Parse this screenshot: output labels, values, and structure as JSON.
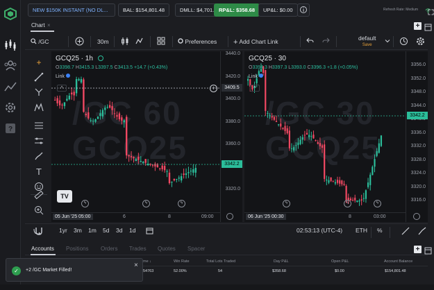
{
  "topbar": {
    "account_label": "NEW $150K INSTANT (NO DL...",
    "bal": "BAL: $154,801.48",
    "dmll": "DMLL: $4,701.48",
    "rpl": "RP&L: $358.68",
    "upl": "UP&L: $0.00",
    "refresh": "Refresh Rate: Medium"
  },
  "chart_tabs": {
    "active": "Chart",
    "close": "×"
  },
  "toolbar": {
    "symbol": "/GC",
    "interval": "30m",
    "preferences": "Preferences",
    "add_link": "Add Chart Link",
    "layout_name": "default",
    "layout_save": "Save"
  },
  "left_pane": {
    "watermark1": "/GC 60",
    "watermark2": "GCQ25",
    "symbol": "GCQ25 · 1h",
    "o": "3398.7",
    "h": "3415.3",
    "l": "3397.5",
    "c": "3413.5",
    "chg": "+14.7 (+0.43%)",
    "link": "Link",
    "crosshair_price": "3409.5",
    "last_price": "3342.2",
    "y_labels": [
      "3440.0",
      "3420.0",
      "3400.0",
      "3380.0",
      "3360.0",
      "3340.0",
      "3320.0"
    ],
    "x_labels": [
      "05 Jun '25  05:00",
      "6",
      "8",
      "09:00"
    ]
  },
  "right_pane": {
    "watermark1": "/GC 30",
    "watermark2": "GCQ25",
    "symbol": "GCQ25 · 30",
    "o": "3394.3",
    "h": "3397.3",
    "l": "3393.0",
    "c": "3396.3",
    "chg": "+1.8 (+0.05%)",
    "link": "Link",
    "last_price": "3342.2",
    "y_labels": [
      "3356.0",
      "3352.0",
      "3348.0",
      "3344.0",
      "3340.0",
      "3336.0",
      "3332.0",
      "3328.0",
      "3324.0",
      "3320.0",
      "3316.0"
    ],
    "x_labels": [
      "06 Jun '25  00:30",
      "8",
      "03:00"
    ]
  },
  "rangebar": {
    "ranges": [
      "1yr",
      "3m",
      "1m",
      "5d",
      "3d",
      "1d"
    ],
    "clock": "02:53:13 (UTC-4)",
    "currency": "ETH",
    "pct": "%"
  },
  "accounts": {
    "tabs": [
      "Accounts",
      "Positions",
      "Orders",
      "Trades",
      "Quotes",
      "Spacer"
    ],
    "headers": [
      "me",
      "Win Rate",
      "Total Lots Traded",
      "Day P&L",
      "Open P&L",
      "Account Balance"
    ],
    "row": [
      "54763",
      "52.00%",
      "54",
      "$358.68",
      "$0.00",
      "$154,801.48"
    ]
  },
  "toast": {
    "message": "+2 /GC Market Filled!"
  },
  "colors": {
    "up": "#2bbd9a",
    "down": "#f04862",
    "price_tag": "#2bbd9a",
    "accent": "#2e8b47"
  }
}
